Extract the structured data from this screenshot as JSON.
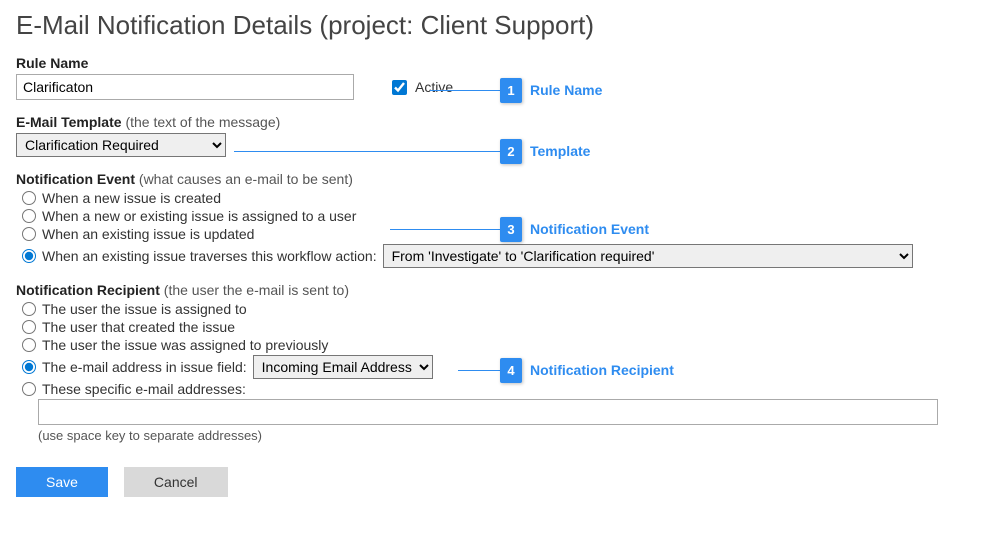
{
  "header": {
    "title": "E-Mail Notification Details (project: Client Support)"
  },
  "ruleName": {
    "label": "Rule Name",
    "value": "Clarificaton",
    "activeLabel": "Active",
    "activeChecked": true
  },
  "template": {
    "label": "E-Mail Template",
    "hint": "(the text of the message)",
    "selected": "Clarification Required"
  },
  "event": {
    "label": "Notification Event",
    "hint": "(what causes an e-mail to be sent)",
    "options": {
      "new": "When a new issue is created",
      "assigned": "When a new or existing issue is assigned to a user",
      "updated": "When an existing issue is updated",
      "workflow": "When an existing issue traverses this workflow action:"
    },
    "workflowSelected": "From 'Investigate' to 'Clarification required'"
  },
  "recipient": {
    "label": "Notification Recipient",
    "hint": "(the user the e-mail is sent to)",
    "options": {
      "assignedTo": "The user the issue is assigned to",
      "creator": "The user that created the issue",
      "prevAssigned": "The user the issue was assigned to previously",
      "emailField": "The e-mail address in issue field:",
      "specific": "These specific e-mail addresses:"
    },
    "emailFieldSelected": "Incoming Email Address",
    "specificValue": "",
    "specificHint": "(use space key to separate addresses)"
  },
  "buttons": {
    "save": "Save",
    "cancel": "Cancel"
  },
  "callouts": {
    "c1": "Rule Name",
    "c2": "Template",
    "c3": "Notification Event",
    "c4": "Notification Recipient"
  }
}
